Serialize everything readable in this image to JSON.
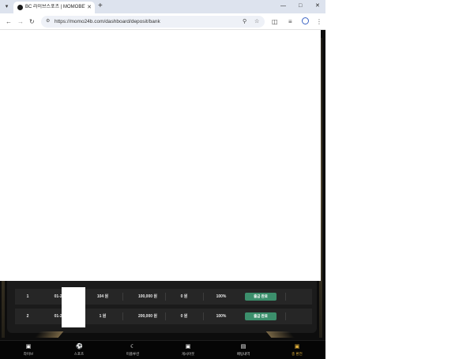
{
  "browser": {
    "tab_title": "BC 라이브스포츠 | MOMOBET",
    "tab_list_icon": "chevron-down-icon",
    "url": "https://momo24b.com/dashboard/deposit/bank"
  },
  "deposits": {
    "rows": [
      {
        "index": "1",
        "date": "01-27",
        "method": "104 원",
        "amount": "100,000 원",
        "bonus": "0 원",
        "rate": "100%",
        "status": "출금 완료"
      },
      {
        "index": "2",
        "date": "01-26",
        "method": "1 원",
        "amount": "200,000 원",
        "bonus": "0 원",
        "rate": "100%",
        "status": "출금 완료"
      }
    ]
  },
  "bottom_nav": {
    "items": [
      {
        "label": "라이브",
        "icon": "live-icon"
      },
      {
        "label": "스포츠",
        "icon": "soccer-ball-icon"
      },
      {
        "label": "미플루션",
        "icon": "moon-icon"
      },
      {
        "label": "게시아웃",
        "icon": "cash-icon"
      },
      {
        "label": "배팅내역",
        "icon": "document-icon"
      },
      {
        "label": "충 환전",
        "icon": "wallet-icon"
      }
    ]
  },
  "colors": {
    "status_badge": "#3c8f6c",
    "active_nav": "#e6b43c",
    "accent_gold": "#a2895a"
  }
}
